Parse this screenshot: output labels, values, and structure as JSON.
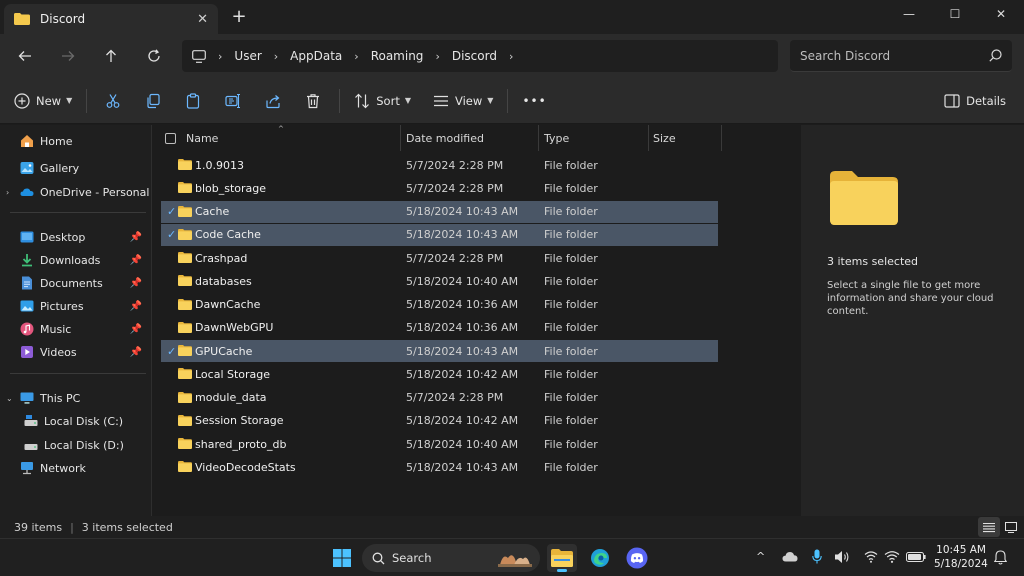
{
  "window": {
    "tab_title": "Discord",
    "new_tab_label": "+",
    "minimize": "—",
    "maximize": "☐",
    "close": "✕"
  },
  "address": {
    "breadcrumbs": [
      "User",
      "AppData",
      "Roaming",
      "Discord"
    ],
    "search_placeholder": "Search Discord"
  },
  "toolbar": {
    "new_label": "New",
    "sort_label": "Sort",
    "view_label": "View",
    "more_label": "•••",
    "details_label": "Details"
  },
  "sidebar": {
    "items": [
      {
        "label": "Home",
        "icon": "home-icon"
      },
      {
        "label": "Gallery",
        "icon": "gallery-icon"
      },
      {
        "label": "OneDrive - Personal",
        "icon": "onedrive-icon"
      },
      {
        "label": "Desktop",
        "icon": "desktop-icon",
        "pinned": true
      },
      {
        "label": "Downloads",
        "icon": "download-icon",
        "pinned": true
      },
      {
        "label": "Documents",
        "icon": "documents-icon",
        "pinned": true
      },
      {
        "label": "Pictures",
        "icon": "pictures-icon",
        "pinned": true
      },
      {
        "label": "Music",
        "icon": "music-icon",
        "pinned": true
      },
      {
        "label": "Videos",
        "icon": "videos-icon",
        "pinned": true
      },
      {
        "label": "This PC",
        "icon": "pc-icon"
      },
      {
        "label": "Local Disk (C:)",
        "icon": "drive-icon"
      },
      {
        "label": "Local Disk (D:)",
        "icon": "drive-icon"
      },
      {
        "label": "Network",
        "icon": "network-icon"
      }
    ]
  },
  "columns": {
    "name": "Name",
    "date": "Date modified",
    "type": "Type",
    "size": "Size"
  },
  "files": [
    {
      "name": "1.0.9013",
      "date": "5/7/2024 2:28 PM",
      "type": "File folder",
      "selected": false
    },
    {
      "name": "blob_storage",
      "date": "5/7/2024 2:28 PM",
      "type": "File folder",
      "selected": false
    },
    {
      "name": "Cache",
      "date": "5/18/2024 10:43 AM",
      "type": "File folder",
      "selected": true
    },
    {
      "name": "Code Cache",
      "date": "5/18/2024 10:43 AM",
      "type": "File folder",
      "selected": true
    },
    {
      "name": "Crashpad",
      "date": "5/7/2024 2:28 PM",
      "type": "File folder",
      "selected": false
    },
    {
      "name": "databases",
      "date": "5/18/2024 10:40 AM",
      "type": "File folder",
      "selected": false
    },
    {
      "name": "DawnCache",
      "date": "5/18/2024 10:36 AM",
      "type": "File folder",
      "selected": false
    },
    {
      "name": "DawnWebGPU",
      "date": "5/18/2024 10:36 AM",
      "type": "File folder",
      "selected": false
    },
    {
      "name": "GPUCache",
      "date": "5/18/2024 10:43 AM",
      "type": "File folder",
      "selected": true
    },
    {
      "name": "Local Storage",
      "date": "5/18/2024 10:42 AM",
      "type": "File folder",
      "selected": false
    },
    {
      "name": "module_data",
      "date": "5/7/2024 2:28 PM",
      "type": "File folder",
      "selected": false
    },
    {
      "name": "Session Storage",
      "date": "5/18/2024 10:42 AM",
      "type": "File folder",
      "selected": false
    },
    {
      "name": "shared_proto_db",
      "date": "5/18/2024 10:40 AM",
      "type": "File folder",
      "selected": false
    },
    {
      "name": "VideoDecodeStats",
      "date": "5/18/2024 10:43 AM",
      "type": "File folder",
      "selected": false
    }
  ],
  "details": {
    "selected_count": "3 items selected",
    "message": "Select a single file to get more information and share your cloud content."
  },
  "status": {
    "items": "39 items",
    "selected": "3 items selected"
  },
  "taskbar": {
    "search_label": "Search",
    "time": "10:45 AM",
    "date": "5/18/2024"
  },
  "colors": {
    "accent": "#4cc2ff",
    "folder": "#f4c94d",
    "selection": "#4a5666",
    "discord": "#5865f2"
  }
}
